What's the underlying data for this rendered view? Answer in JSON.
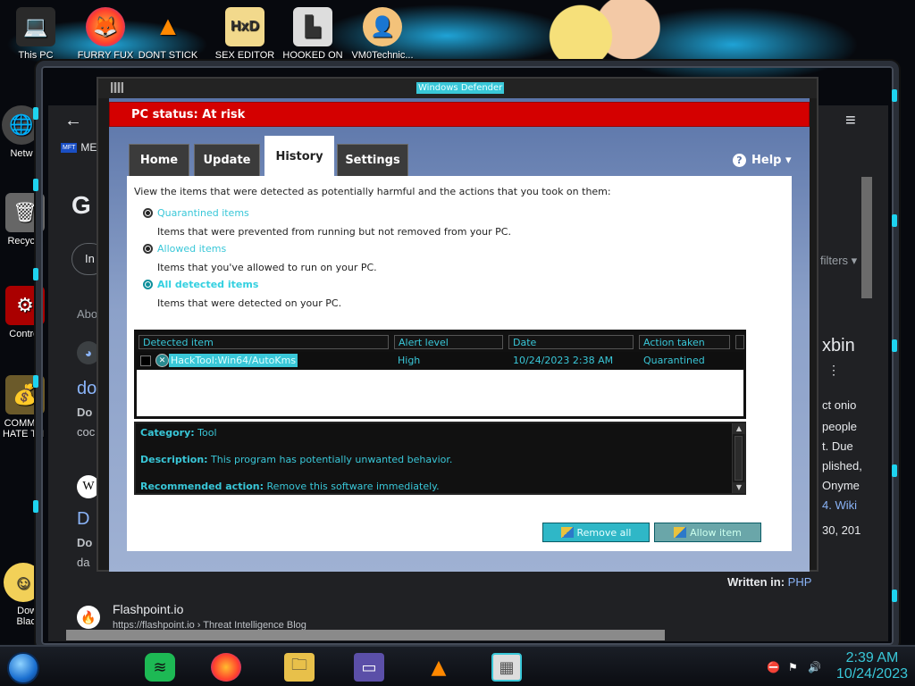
{
  "desktop": {
    "icons": [
      {
        "label": "This PC",
        "icon": "laptop-icon"
      },
      {
        "label": "FURRY FUX",
        "icon": "firefox-icon"
      },
      {
        "label": "DONT STICK",
        "icon": "vlc-cone-icon"
      },
      {
        "label": "SEX EDITOR",
        "icon": "hex-editor-icon"
      },
      {
        "label": "HOOKED ON",
        "icon": "maze-icon"
      },
      {
        "label": "VM0Technic...",
        "icon": "person-icon"
      }
    ],
    "left_icons": [
      {
        "label": "Netw",
        "icon": "network-icon"
      },
      {
        "label": "Recycle",
        "icon": "recycle-bin-icon"
      },
      {
        "label": "Control",
        "icon": "control-panel-icon"
      },
      {
        "label": "COMMU HATE TH",
        "icon": "money-bag-icon"
      },
      {
        "label": "Dowr Black",
        "icon": "cartoon-icon"
      }
    ]
  },
  "browser": {
    "back": "←",
    "menu": "≡",
    "tab_label": "ME",
    "google_letter": "G",
    "search_fragment": "In",
    "filters": "filters",
    "about": "Abo",
    "left_texts": [
      "do",
      "Do",
      "coc",
      "D",
      "Do",
      "da"
    ],
    "right_title": "xbin",
    "right_lines": [
      "ct onio",
      "people",
      "t. Due",
      "plished,",
      "Onyme",
      "4. Wiki",
      "30, 201"
    ],
    "written_in_label": "Written in:",
    "written_in_value": "PHP",
    "result_title": "Flashpoint.io",
    "result_url": "https://flashpoint.io › Threat Intelligence Blog"
  },
  "defender": {
    "window_title": "Windows Defender",
    "status": "PC status: At risk",
    "tabs": [
      {
        "label": "Home",
        "active": false
      },
      {
        "label": "Update",
        "active": false
      },
      {
        "label": "History",
        "active": true
      },
      {
        "label": "Settings",
        "active": false
      }
    ],
    "help": "Help ▾",
    "intro": "View the items that were detected as potentially harmful and the actions that you took on them:",
    "options": [
      {
        "label": "Quarantined items",
        "desc": "Items that were prevented from running but not removed from your PC.",
        "selected": false
      },
      {
        "label": "Allowed items",
        "desc": "Items that you've allowed to run on your PC.",
        "selected": false
      },
      {
        "label": "All detected items",
        "desc": "Items that were detected on your PC.",
        "selected": true
      }
    ],
    "columns": [
      "Detected item",
      "Alert level",
      "Date",
      "Action taken"
    ],
    "rows": [
      {
        "item": "HackTool:Win64/AutoKms",
        "alert": "High",
        "date": "10/24/2023 2:38 AM",
        "action": "Quarantined"
      }
    ],
    "details": {
      "category_label": "Category:",
      "category_value": "Tool",
      "description_label": "Description:",
      "description_value": "This program has potentially unwanted behavior.",
      "recommended_label": "Recommended action:",
      "recommended_value": "Remove this software immediately."
    },
    "buttons": {
      "remove_all": "Remove all",
      "allow_item": "Allow item"
    }
  },
  "taskbar": {
    "apps": [
      "start-orb-icon",
      "spotify-icon",
      "firefox-icon",
      "file-explorer-icon",
      "id-card-icon",
      "vlc-icon",
      "firewall-icon"
    ],
    "time": "2:39 AM",
    "date": "10/24/2023"
  },
  "colors": {
    "accent": "#39c7d8",
    "status_red": "#d40000",
    "panel_bg": "#ffffff"
  }
}
